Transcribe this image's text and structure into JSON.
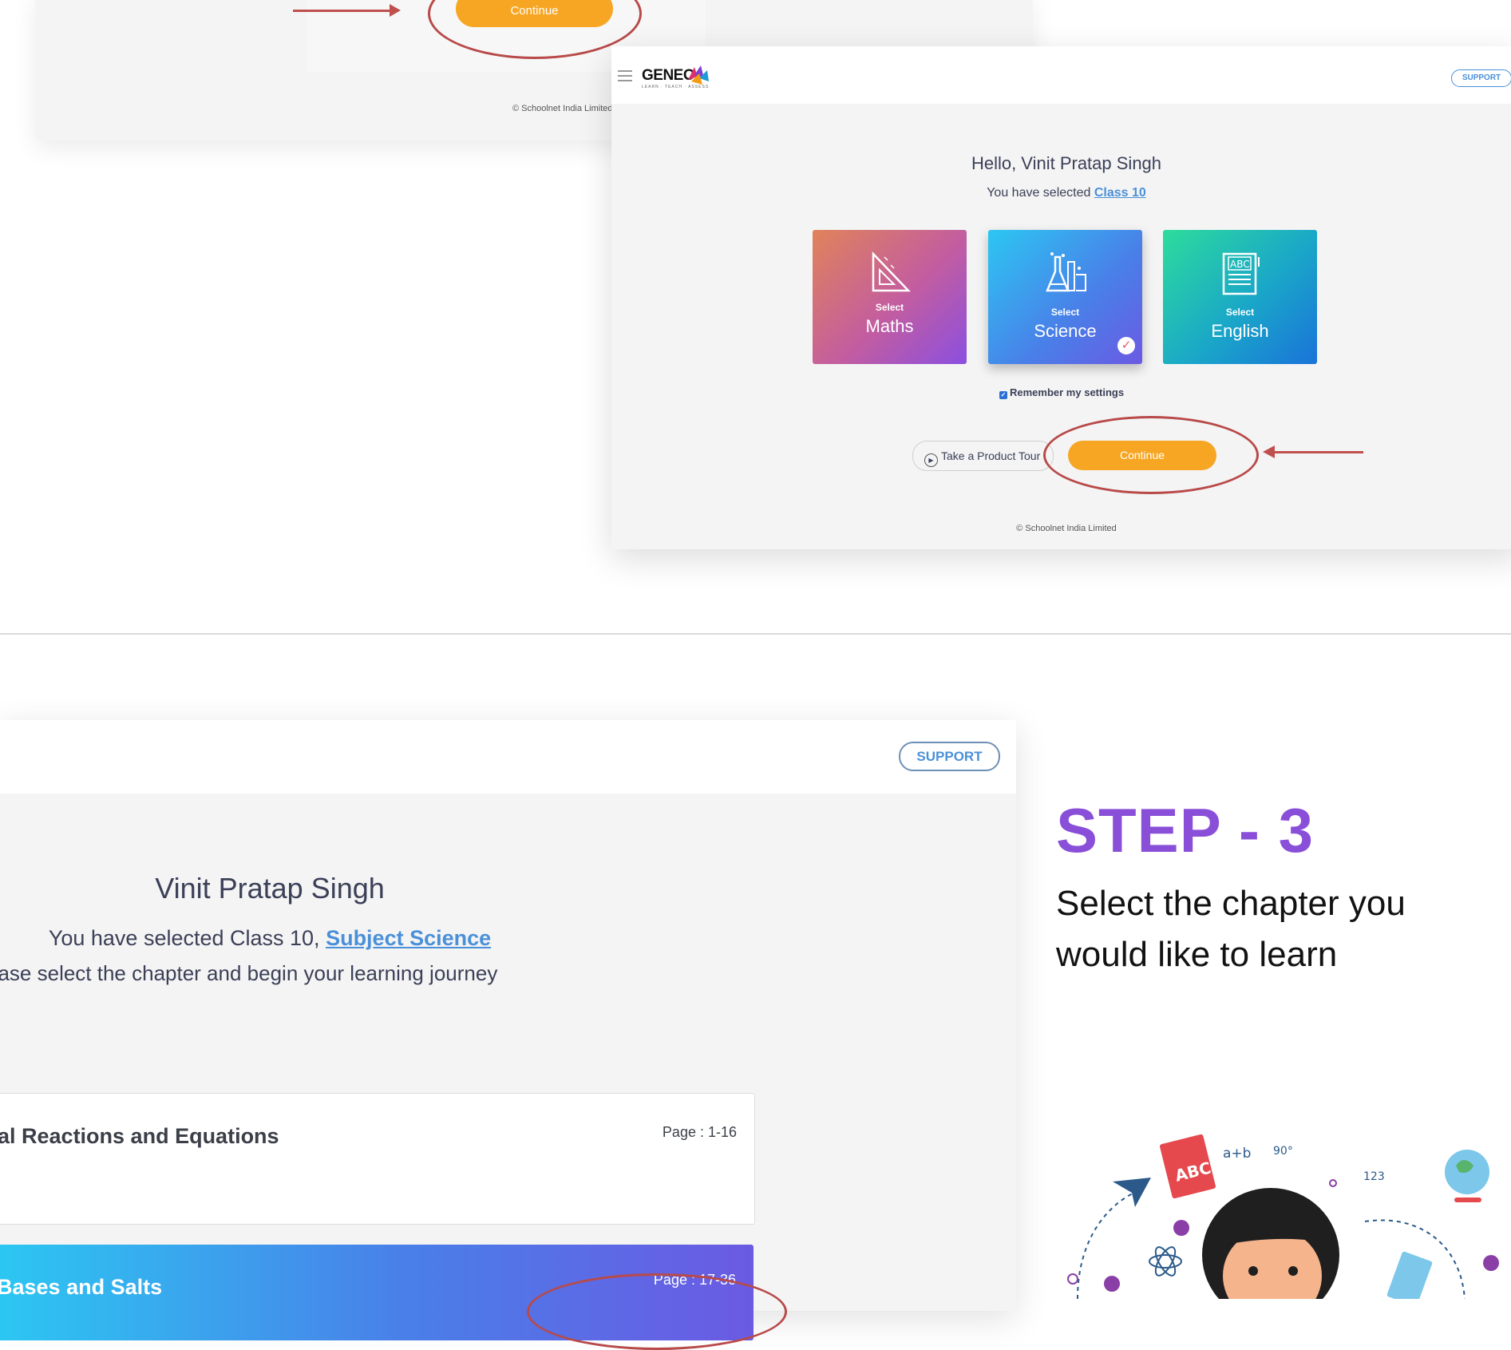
{
  "screenshot_step2_prev": {
    "continue_label": "Continue",
    "footer": "© Schoolnet India Limited"
  },
  "screenshot_subject": {
    "brand": "GENEO",
    "brand_tagline": "LEARN · TEACH · ASSESS",
    "support_label": "SUPPORT",
    "greeting": "Hello, Vinit Pratap Singh",
    "selected_prefix": "You have selected ",
    "selected_class": "Class 10",
    "subjects": [
      {
        "select_label": "Select",
        "name": "Maths",
        "icon": "set-square-icon"
      },
      {
        "select_label": "Select",
        "name": "Science",
        "icon": "lab-flask-icon",
        "selected": true
      },
      {
        "select_label": "Select",
        "name": "English",
        "icon": "abc-book-icon"
      }
    ],
    "remember_label": "Remember my settings",
    "remember_checked": true,
    "tour_label": "Take a Product Tour",
    "continue_label": "Continue",
    "footer": "© Schoolnet India Limited",
    "colors": {
      "continue": "#f7a623",
      "highlight_ring": "#b84a49",
      "link": "#4a90d9"
    }
  },
  "screenshot_chapter": {
    "support_label": "SUPPORT",
    "student_name": "Vinit Pratap Singh",
    "class_prefix": "You have selected Class 10, ",
    "subject_link": "Subject Science",
    "instruction": "ease select the chapter and begin your learning journey",
    "chapters": [
      {
        "title": "al Reactions and Equations",
        "pages": "Page : 1-16"
      },
      {
        "title": "Bases and Salts",
        "pages": "Page : 17-36"
      }
    ]
  },
  "step": {
    "title": "STEP - 3",
    "description": "Select the chapter you would like to learn",
    "title_color": "#8a4fd8"
  },
  "illustration": {
    "texts": [
      "ABC",
      "a+b",
      "90°",
      "123"
    ]
  }
}
